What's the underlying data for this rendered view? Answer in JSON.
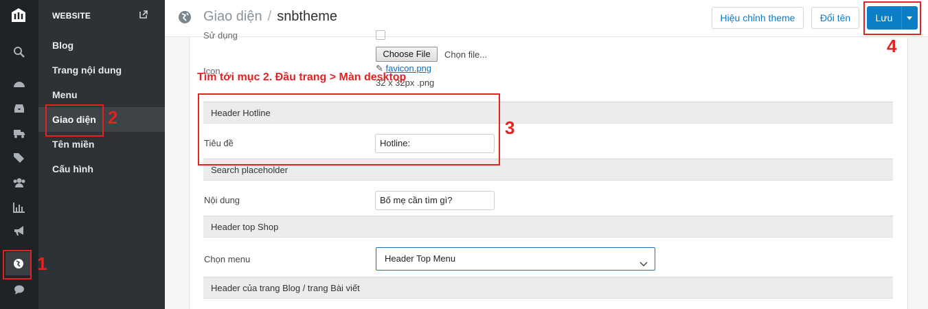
{
  "rail": {
    "icons": [
      "logo-icon",
      "search-icon",
      "dashboard-icon",
      "inbox-icon",
      "truck-icon",
      "tags-icon",
      "users-icon",
      "chart-icon",
      "megaphone-icon",
      "globe-icon",
      "chat-icon"
    ]
  },
  "sidebar": {
    "heading": "WEBSITE",
    "items": [
      {
        "label": "Blog"
      },
      {
        "label": "Trang nội dung"
      },
      {
        "label": "Menu"
      },
      {
        "label": "Giao diện"
      },
      {
        "label": "Tên miền"
      },
      {
        "label": "Cấu hình"
      }
    ]
  },
  "topbar": {
    "crumb_parent": "Giao diện",
    "crumb_sep": "/",
    "crumb_current": "snbtheme",
    "edit_theme": "Hiệu chỉnh theme",
    "rename": "Đổi tên",
    "save": "Lưu"
  },
  "form": {
    "partial_label": "Sử dụng",
    "choose_file": "Choose File",
    "choose_file_hint": "Chọn file...",
    "icon_label": "Icon",
    "icon_file": "favicon.png",
    "icon_size": "32 x 32px .png",
    "sections": [
      {
        "title": "Header Hotline",
        "field_label": "Tiêu đề",
        "field_value": "Hotline:"
      },
      {
        "title": "Search placeholder",
        "field_label": "Nội dung",
        "field_value": "Bố mẹ cần tìm gì?"
      },
      {
        "title": "Header top Shop",
        "field_label": "Chọn menu",
        "field_value": "Header Top Menu"
      },
      {
        "title": "Header của trang Blog / trang Bài viết"
      }
    ]
  },
  "annotations": {
    "instruction": "Tìm tới mục 2. Đầu trang > Màn desktop",
    "n1": "1",
    "n2": "2",
    "n3": "3",
    "n4": "4",
    "color": "#e32222"
  },
  "colors": {
    "primary": "#0a7fc6",
    "rail_bg": "#1f2326",
    "sidebar_bg": "#2d3236"
  }
}
